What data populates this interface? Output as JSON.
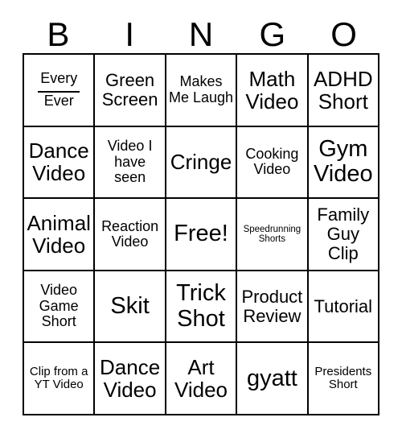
{
  "card": {
    "type": "bingo-card",
    "header_letters": [
      "B",
      "I",
      "N",
      "G",
      "O"
    ],
    "grid_size": "5x5",
    "free_space": {
      "row": 3,
      "column": 3,
      "label": "Free!"
    },
    "colors": {
      "background": "#ffffff",
      "text": "#000000",
      "border": "#000000"
    },
    "rows": [
      [
        {
          "line1": "Every",
          "line2": "Ever",
          "has_blank_rule": true,
          "size": "m"
        },
        {
          "text": "Green Screen",
          "size": "l"
        },
        {
          "text": "Makes Me Laugh",
          "size": "m"
        },
        {
          "text": "Math Video",
          "size": "xl"
        },
        {
          "text": "ADHD Short",
          "size": "xl"
        }
      ],
      [
        {
          "text": "Dance Video",
          "size": "xl"
        },
        {
          "text": "Video I have seen",
          "size": "m"
        },
        {
          "text": "Cringe",
          "size": "xl"
        },
        {
          "text": "Cooking Video",
          "size": "m"
        },
        {
          "text": "Gym Video",
          "size": "xxl"
        }
      ],
      [
        {
          "text": "Animal Video",
          "size": "xl"
        },
        {
          "text": "Reaction Video",
          "size": "m"
        },
        {
          "text": "Free!",
          "size": "xxl"
        },
        {
          "text": "Speedrunning Shorts",
          "size": "xs"
        },
        {
          "text": "Family Guy Clip",
          "size": "l"
        }
      ],
      [
        {
          "text": "Video Game Short",
          "size": "m"
        },
        {
          "text": "Skit",
          "size": "xxl"
        },
        {
          "text": "Trick Shot",
          "size": "xxl"
        },
        {
          "text": "Product Review",
          "size": "l"
        },
        {
          "text": "Tutorial",
          "size": "l"
        }
      ],
      [
        {
          "text": "Clip from a YT Video",
          "size": "s"
        },
        {
          "text": "Dance Video",
          "size": "xl"
        },
        {
          "text": "Art Video",
          "size": "xl"
        },
        {
          "text": "gyatt",
          "size": "xxl"
        },
        {
          "text": "Presidents Short",
          "size": "s"
        }
      ]
    ]
  }
}
